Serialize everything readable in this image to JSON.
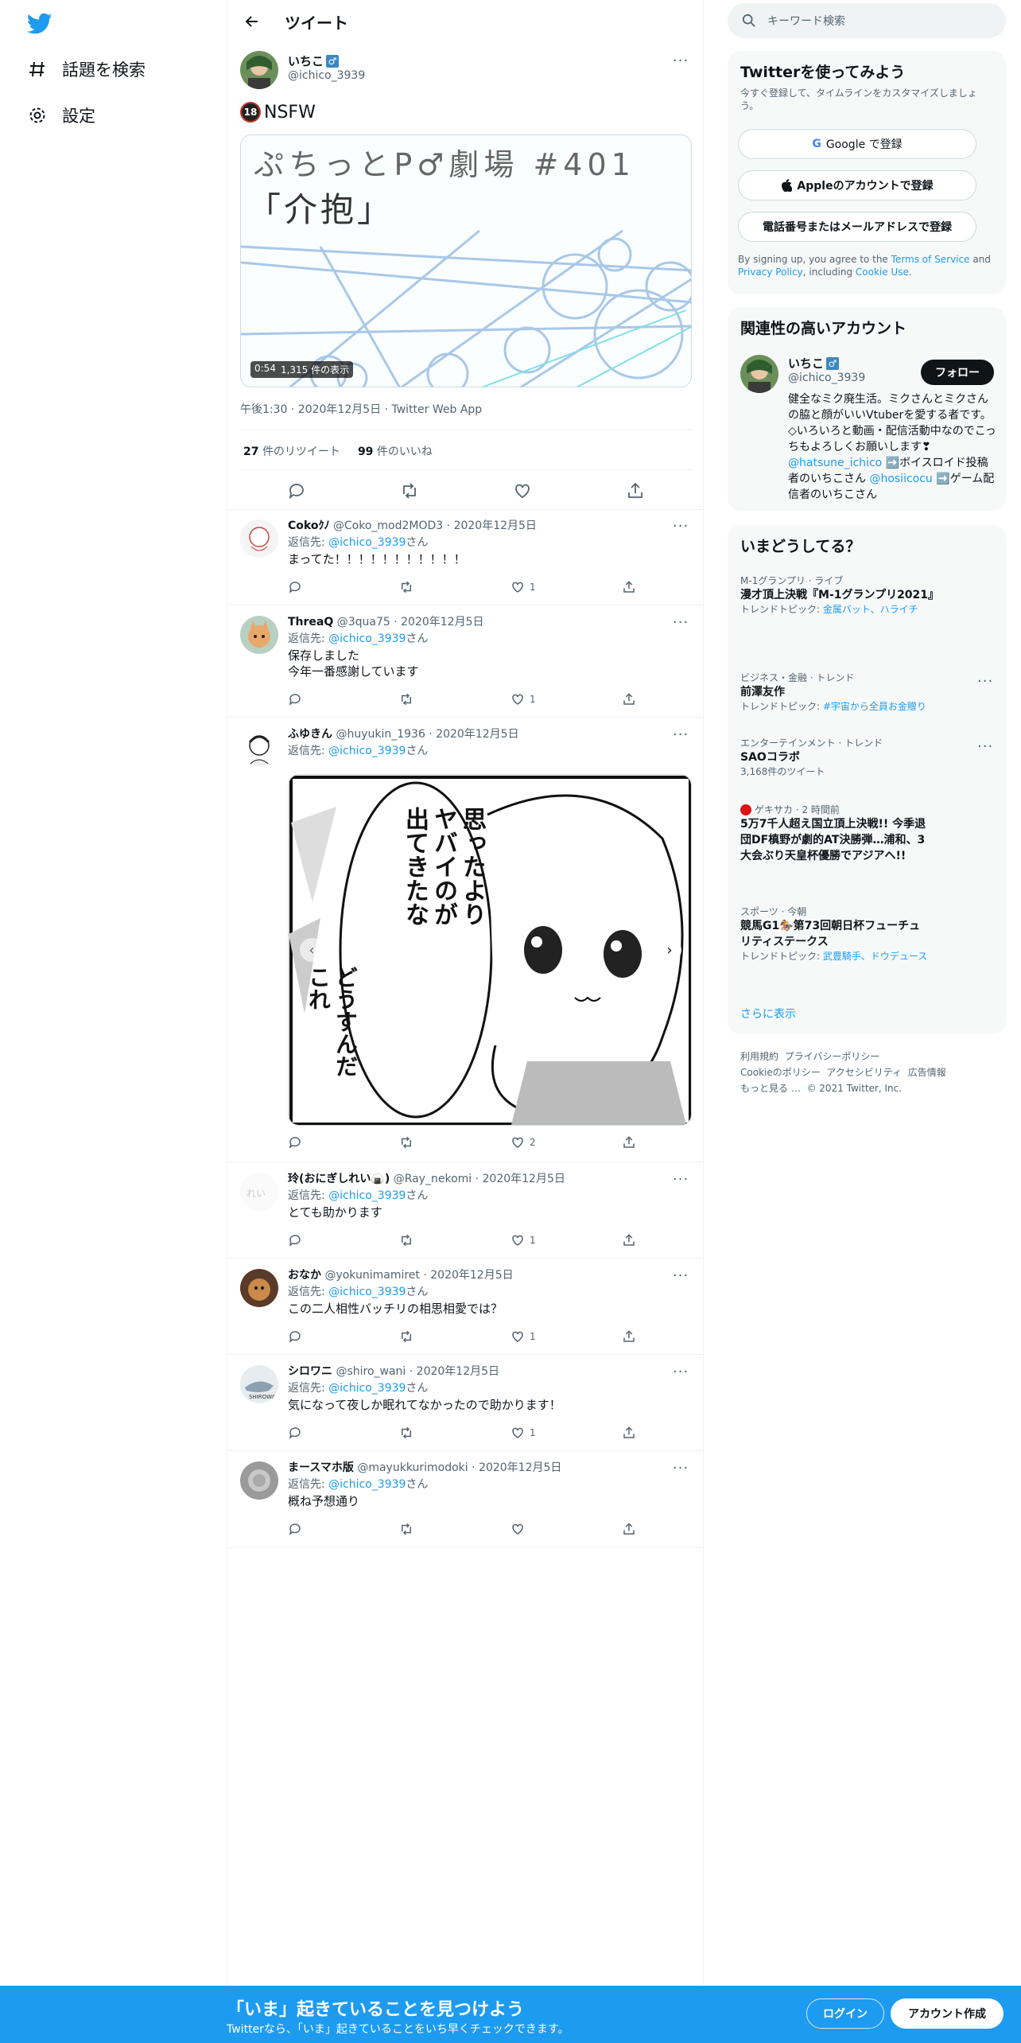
{
  "nav": {
    "explore": "話題を検索",
    "settings": "設定"
  },
  "header": {
    "title": "ツイート"
  },
  "tweet": {
    "name": "いちこ",
    "gender_badge": "♂",
    "handle": "@ichico_3939",
    "text": "NSFW",
    "r18_badge": "18",
    "media": {
      "title_line1": "ぷちっとP♂劇場 #401",
      "title_line2": "「介抱」",
      "duration": "0:54",
      "views": "1,315 件の表示"
    },
    "meta": "午後1:30 · 2020年12月5日 · Twitter Web App",
    "retweets": "27",
    "retweets_label": "件のリツイート",
    "likes": "99",
    "likes_label": "件のいいね"
  },
  "replies": [
    {
      "name": "Cokoｸﾉ",
      "handle": "@Coko_mod2MOD3",
      "date": "· 2020年12月5日",
      "to_prefix": "返信先: ",
      "to": "@ichico_3939",
      "to_suffix": "さん",
      "text": "まってた！！！！！！！！！！！",
      "likes": "1"
    },
    {
      "name": "ThreaQ",
      "handle": "@3qua75",
      "date": "· 2020年12月5日",
      "to_prefix": "返信先: ",
      "to": "@ichico_3939",
      "to_suffix": "さん",
      "text": "保存しました\n今年一番感謝しています",
      "likes": "1"
    },
    {
      "name": "ふゆきん",
      "handle": "@huyukin_1936",
      "date": "· 2020年12月5日",
      "to_prefix": "返信先: ",
      "to": "@ichico_3939",
      "to_suffix": "さん",
      "text": "",
      "likes": "2",
      "image_text": [
        "思ったより",
        "ヤバイのが",
        "出てきたな",
        "どうすんだ",
        "これ"
      ]
    },
    {
      "name": "玲(おにぎしれい🍙)",
      "handle": "@Ray_nekomi",
      "date": "· 2020年12月5日",
      "to_prefix": "返信先: ",
      "to": "@ichico_3939",
      "to_suffix": "さん",
      "text": "とても助かります",
      "likes": "1"
    },
    {
      "name": "おなか",
      "handle": "@yokunimamiret",
      "date": "· 2020年12月5日",
      "to_prefix": "返信先: ",
      "to": "@ichico_3939",
      "to_suffix": "さん",
      "text": "この二人相性バッチリの相思相愛では？",
      "likes": "1"
    },
    {
      "name": "シロワニ",
      "handle": "@shiro_wani",
      "date": "· 2020年12月5日",
      "to_prefix": "返信先: ",
      "to": "@ichico_3939",
      "to_suffix": "さん",
      "text": "気になって夜しか眠れてなかったので助かります！",
      "likes": "1"
    },
    {
      "name": "まースマホ版",
      "handle": "@mayukkurimodoki",
      "date": "· 2020年12月5日",
      "to_prefix": "返信先: ",
      "to": "@ichico_3939",
      "to_suffix": "さん",
      "text": "概ね予想通り",
      "likes": ""
    }
  ],
  "sidebar": {
    "search_placeholder": "キーワード検索",
    "signup": {
      "title": "Twitterを使ってみよう",
      "subtitle": "今すぐ登録して、タイムラインをカスタマイズしましょう。",
      "google": "Google で登録",
      "apple": "Appleのアカウントで登録",
      "phone": "電話番号またはメールアドレスで登録",
      "legal_prefix": "By signing up, you agree to the ",
      "terms": "Terms of Service",
      "and": " and ",
      "privacy": "Privacy Policy",
      "including": ", including ",
      "cookie": "Cookie Use",
      "dot": "."
    },
    "related": {
      "title": "関連性の高いアカウント",
      "name": "いちこ",
      "badge": "♂",
      "handle": "@ichico_3939",
      "follow": "フォロー",
      "bio": "健全なミク廃生活。ミクさんとミクさんの脇と顔がいいVtuberを愛する者です。◇いろいろと動画・配信活動中なのでこっちもよろしくお願いします❣",
      "mention1": "@hatsune_ichico",
      "bio2": "➡️ボイスロイド投稿者のいちこさん",
      "mention2": "@hosiicocu",
      "bio3": "➡️ゲーム配信者のいちこさん"
    },
    "trends": {
      "title": "いまどうしてる？",
      "items": [
        {
          "cat": "M-1グランプリ · ライブ",
          "title": "漫才頂上決戦『M-1グランプリ2021』",
          "sub_prefix": "トレンドトピック: ",
          "sub_link": "金属バット、ハライチ"
        },
        {
          "cat": "ビジネス・金融 · トレンド",
          "title": "前澤友作",
          "sub_prefix": "トレンドトピック: ",
          "sub_link": "#宇宙から全員お金贈り"
        },
        {
          "cat": "エンターテインメント · トレンド",
          "title": "SAOコラボ",
          "sub": "3,168件のツイート"
        },
        {
          "cat": "ゲキサカ · 2 時間前",
          "title": "5万7千人超え国立頂上決戦!! 今季退団DF槙野が劇的AT決勝弾…浦和、3大会ぶり天皇杯優勝でアジアへ!!"
        },
        {
          "cat": "スポーツ · 今朝",
          "title": "競馬G1🏇第73回朝日杯フューチュリティステークス",
          "sub_prefix": "トレンドトピック: ",
          "sub_link": "武豊騎手、ドウデュース"
        }
      ],
      "more": "さらに表示"
    },
    "footer": [
      "利用規約",
      "プライバシーポリシー",
      "Cookieのポリシー",
      "アクセシビリティ",
      "広告情報",
      "もっと見る …",
      "© 2021 Twitter, Inc."
    ]
  },
  "bottom": {
    "title": "「いま」起きていることを見つけよう",
    "sub": "Twitterなら、「いま」起きていることをいち早くチェックできます。",
    "login": "ログイン",
    "signup": "アカウント作成"
  }
}
